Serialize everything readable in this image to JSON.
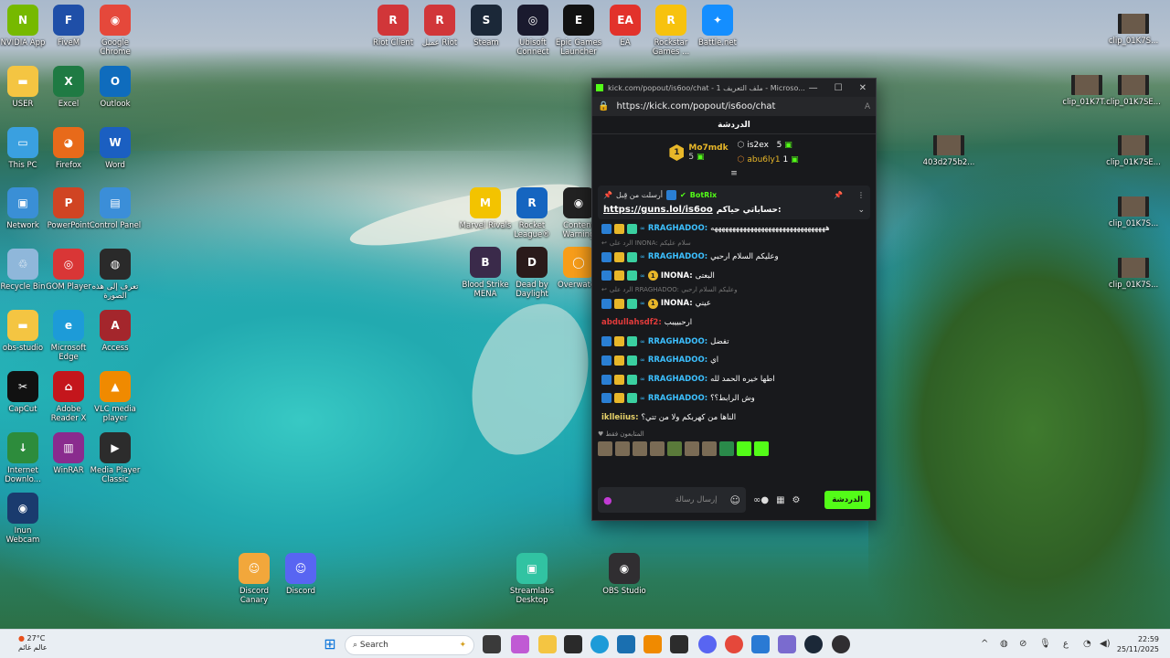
{
  "desktop": {
    "icons_left": [
      {
        "label": "NVIDIA App",
        "color": "#76b900",
        "glyph": "N"
      },
      {
        "label": "FiveM",
        "color": "#1f4fa8",
        "glyph": "F"
      },
      {
        "label": "Google\nChrome",
        "color": "#e5483b",
        "glyph": "◉"
      },
      {
        "label": "USER",
        "color": "#f4c542",
        "glyph": "▬"
      },
      {
        "label": "Excel",
        "color": "#1f7a43",
        "glyph": "X"
      },
      {
        "label": "Outlook",
        "color": "#0f6cbd",
        "glyph": "O"
      },
      {
        "label": "This PC",
        "color": "#3aa0e0",
        "glyph": "▭"
      },
      {
        "label": "Firefox",
        "color": "#e86a1a",
        "glyph": "◕"
      },
      {
        "label": "Word",
        "color": "#1b5fc1",
        "glyph": "W"
      },
      {
        "label": "Network",
        "color": "#3a8fd6",
        "glyph": "▣"
      },
      {
        "label": "PowerPoint",
        "color": "#d04423",
        "glyph": "P"
      },
      {
        "label": "Control Panel",
        "color": "#3b8ed8",
        "glyph": "▤"
      },
      {
        "label": "Recycle Bin",
        "color": "#8fb7da",
        "glyph": "♲"
      },
      {
        "label": "GOM Player",
        "color": "#d93636",
        "glyph": "◎"
      },
      {
        "label": "تعرف إلى هذه\nالصورة",
        "color": "#2a2a2a",
        "glyph": "◍"
      },
      {
        "label": "obs-studio",
        "color": "#f4c542",
        "glyph": "▬"
      },
      {
        "label": "Microsoft\nEdge",
        "color": "#1d9bd8",
        "glyph": "e"
      },
      {
        "label": "Access",
        "color": "#a4262c",
        "glyph": "A"
      },
      {
        "label": "CapCut",
        "color": "#111111",
        "glyph": "✂"
      },
      {
        "label": "Adobe\nReader X",
        "color": "#c4161c",
        "glyph": "⌂"
      },
      {
        "label": "VLC media\nplayer",
        "color": "#f08a00",
        "glyph": "▲"
      },
      {
        "label": "Internet\nDownlo...",
        "color": "#2d8c3c",
        "glyph": "↓"
      },
      {
        "label": "WinRAR",
        "color": "#8a2b8e",
        "glyph": "▥"
      },
      {
        "label": "Media Player\nClassic",
        "color": "#2c2c2c",
        "glyph": "▶"
      },
      {
        "label": "Inun\nWebcam",
        "color": "#1a3b6e",
        "glyph": "◉"
      }
    ],
    "icons_top": [
      {
        "label": "Riot Client",
        "color": "#d13639",
        "glyph": "R"
      },
      {
        "label": "عميل Riot",
        "color": "#d13639",
        "glyph": "R"
      },
      {
        "label": "Steam",
        "color": "#1b2838",
        "glyph": "S"
      },
      {
        "label": "Ubisoft\nConnect",
        "color": "#1a1a2e",
        "glyph": "◎"
      },
      {
        "label": "Epic Games\nLauncher",
        "color": "#111111",
        "glyph": "E"
      },
      {
        "label": "EA",
        "color": "#e2322b",
        "glyph": "EA"
      },
      {
        "label": "Rockstar\nGames ...",
        "color": "#f7c20e",
        "glyph": "R"
      },
      {
        "label": "Battle.net",
        "color": "#148eff",
        "glyph": "✦"
      }
    ],
    "icons_mid": [
      {
        "label": "Marvel Rivals",
        "color": "#f3c300",
        "glyph": "M"
      },
      {
        "label": "Rocket\nLeague®",
        "color": "#1565c0",
        "glyph": "R"
      },
      {
        "label": "Content\nWarning",
        "color": "#222222",
        "glyph": "◉"
      },
      {
        "label": "Blood Strike\nMENA",
        "color": "#3a2a4a",
        "glyph": "B"
      },
      {
        "label": "Dead by\nDaylight",
        "color": "#2a1a1a",
        "glyph": "D"
      },
      {
        "label": "Overwatch",
        "color": "#f99e1a",
        "glyph": "◯"
      }
    ],
    "icons_bottom": [
      {
        "label": "Discord\nCanary",
        "color": "#f2a73b",
        "glyph": "☺"
      },
      {
        "label": "Discord",
        "color": "#5865f2",
        "glyph": "☺"
      },
      {
        "label": "Streamlabs\nDesktop",
        "color": "#31c3a2",
        "glyph": "▣"
      },
      {
        "label": "OBS Studio",
        "color": "#302e31",
        "glyph": "◉"
      }
    ],
    "icons_right": [
      {
        "label": "clip_01K7S..."
      },
      {
        "label": "clip_01K7T..."
      },
      {
        "label": "clip_01K7SE..."
      },
      {
        "label": "403d275b2..."
      },
      {
        "label": "clip_01K7SE..."
      },
      {
        "label": "clip_01K7S..."
      },
      {
        "label": "clip_01K7S..."
      }
    ]
  },
  "browser": {
    "title": "kick.com/popout/is6oo/chat - ملف التعريف 1 - Microso...",
    "url": "https://kick.com/popout/is6oo/chat",
    "chat_title": "الدردشة",
    "leaderboard": {
      "first": {
        "rank": "1",
        "name": "Mo7mdk",
        "count": "5"
      },
      "second": {
        "name": "is2ex",
        "count": "5"
      },
      "third": {
        "name": "abu6ly1",
        "count": "1"
      }
    },
    "pinned": {
      "meta": "أرسلت من قِبل",
      "bot": "BotRix",
      "text": "حساباتي حياكم:",
      "link": "https://guns.lol/is6oo"
    },
    "messages": [
      {
        "type": "msg",
        "user": "RRAGHADOO:",
        "text": "ههههههههههههههههههههههههههههههههه",
        "badges": true,
        "color": "#3cc0ff",
        "gold": false
      },
      {
        "type": "reply",
        "text": "الرد على INONA: سلام عليكم"
      },
      {
        "type": "msg",
        "user": "RRAGHADOO:",
        "text": "وعليكم السلام ارحبي",
        "badges": true,
        "color": "#3cc0ff",
        "gold": false
      },
      {
        "type": "msg",
        "user": "INONA:",
        "text": "البعتى",
        "badges": true,
        "color": "#ffffff",
        "gold": true
      },
      {
        "type": "reply",
        "text": "الرد على RRAGHADOO: وعليكم السلام ارحبي"
      },
      {
        "type": "msg",
        "user": "INONA:",
        "text": "عيني",
        "badges": true,
        "color": "#ffffff",
        "gold": true
      },
      {
        "type": "msg",
        "user": "abdullahsdf2:",
        "text": "ارحبييبب",
        "badges": false,
        "color": "#e23b3b",
        "gold": false
      },
      {
        "type": "msg",
        "user": "RRAGHADOO:",
        "text": "تفضل",
        "badges": true,
        "color": "#3cc0ff",
        "gold": false
      },
      {
        "type": "msg",
        "user": "RRAGHADOO:",
        "text": "اي",
        "badges": true,
        "color": "#3cc0ff",
        "gold": false
      },
      {
        "type": "msg",
        "user": "RRAGHADOO:",
        "text": "اطها خيره الحمد لله",
        "badges": true,
        "color": "#3cc0ff",
        "gold": false
      },
      {
        "type": "msg",
        "user": "RRAGHADOO:",
        "text": "وش الرابط؟؟",
        "badges": true,
        "color": "#3cc0ff",
        "gold": false
      },
      {
        "type": "msg",
        "user": "iklleiius:",
        "text": "الناها من كهربكم ولا من تتي؟",
        "badges": false,
        "color": "#e8d36a",
        "gold": false
      }
    ],
    "emote_section": "المتابعون فقط",
    "input_placeholder": "إرسال رسالة",
    "send_label": "الدردشة",
    "accent": "#53fc18"
  },
  "taskbar": {
    "weather_temp": "27°C",
    "weather_text": "عالم غائم",
    "search_label": "Search",
    "time": "22:59",
    "date": "25/11/2025",
    "lang": "ع"
  }
}
